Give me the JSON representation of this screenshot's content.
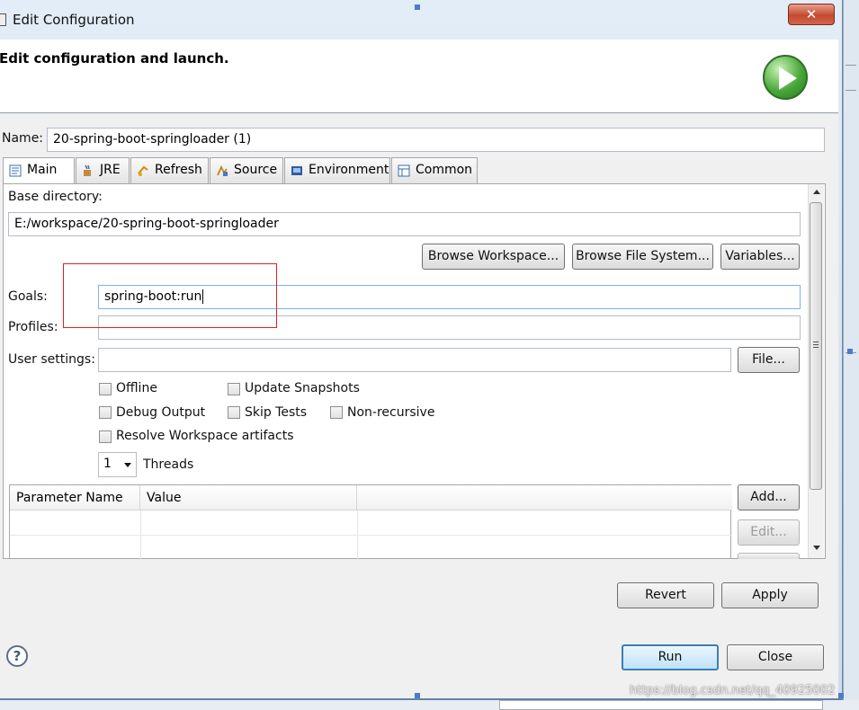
{
  "window": {
    "title": "Edit Configuration",
    "close_glyph": "✕"
  },
  "header": {
    "description": "Edit configuration and launch."
  },
  "name_row": {
    "label": "Name:",
    "value": "20-spring-boot-springloader (1)"
  },
  "tabs": [
    {
      "label": "Main",
      "icon": "main-tab-icon",
      "active": true
    },
    {
      "label": "JRE",
      "icon": "jre-icon"
    },
    {
      "label": "Refresh",
      "icon": "refresh-icon"
    },
    {
      "label": "Source",
      "icon": "source-icon"
    },
    {
      "label": "Environment",
      "icon": "environment-icon"
    },
    {
      "label": "Common",
      "icon": "common-icon"
    }
  ],
  "main": {
    "base_dir_label": "Base directory:",
    "base_dir_value": "E:/workspace/20-spring-boot-springloader",
    "browse_workspace": "Browse Workspace...",
    "browse_fs": "Browse File System...",
    "variables": "Variables...",
    "goals_label": "Goals:",
    "goals_value": "spring-boot:run",
    "profiles_label": "Profiles:",
    "profiles_value": "",
    "user_settings_label": "User settings:",
    "user_settings_value": "",
    "file_button": "File...",
    "checkboxes": {
      "offline": "Offline",
      "update_snapshots": "Update Snapshots",
      "debug_output": "Debug Output",
      "skip_tests": "Skip Tests",
      "non_recursive": "Non-recursive",
      "resolve_workspace": "Resolve Workspace artifacts"
    },
    "threads_value": "1",
    "threads_label": "Threads",
    "table": {
      "columns": [
        "Parameter Name",
        "Value"
      ]
    },
    "add_button": "Add...",
    "edit_button": "Edit..."
  },
  "footer": {
    "revert": "Revert",
    "apply": "Apply",
    "run": "Run",
    "close": "Close",
    "help_glyph": "?"
  },
  "watermark": "https://blog.csdn.net/qq_40925002",
  "colors": {
    "highlight_box": "#e02020",
    "default_button": "#3c7fb1"
  }
}
